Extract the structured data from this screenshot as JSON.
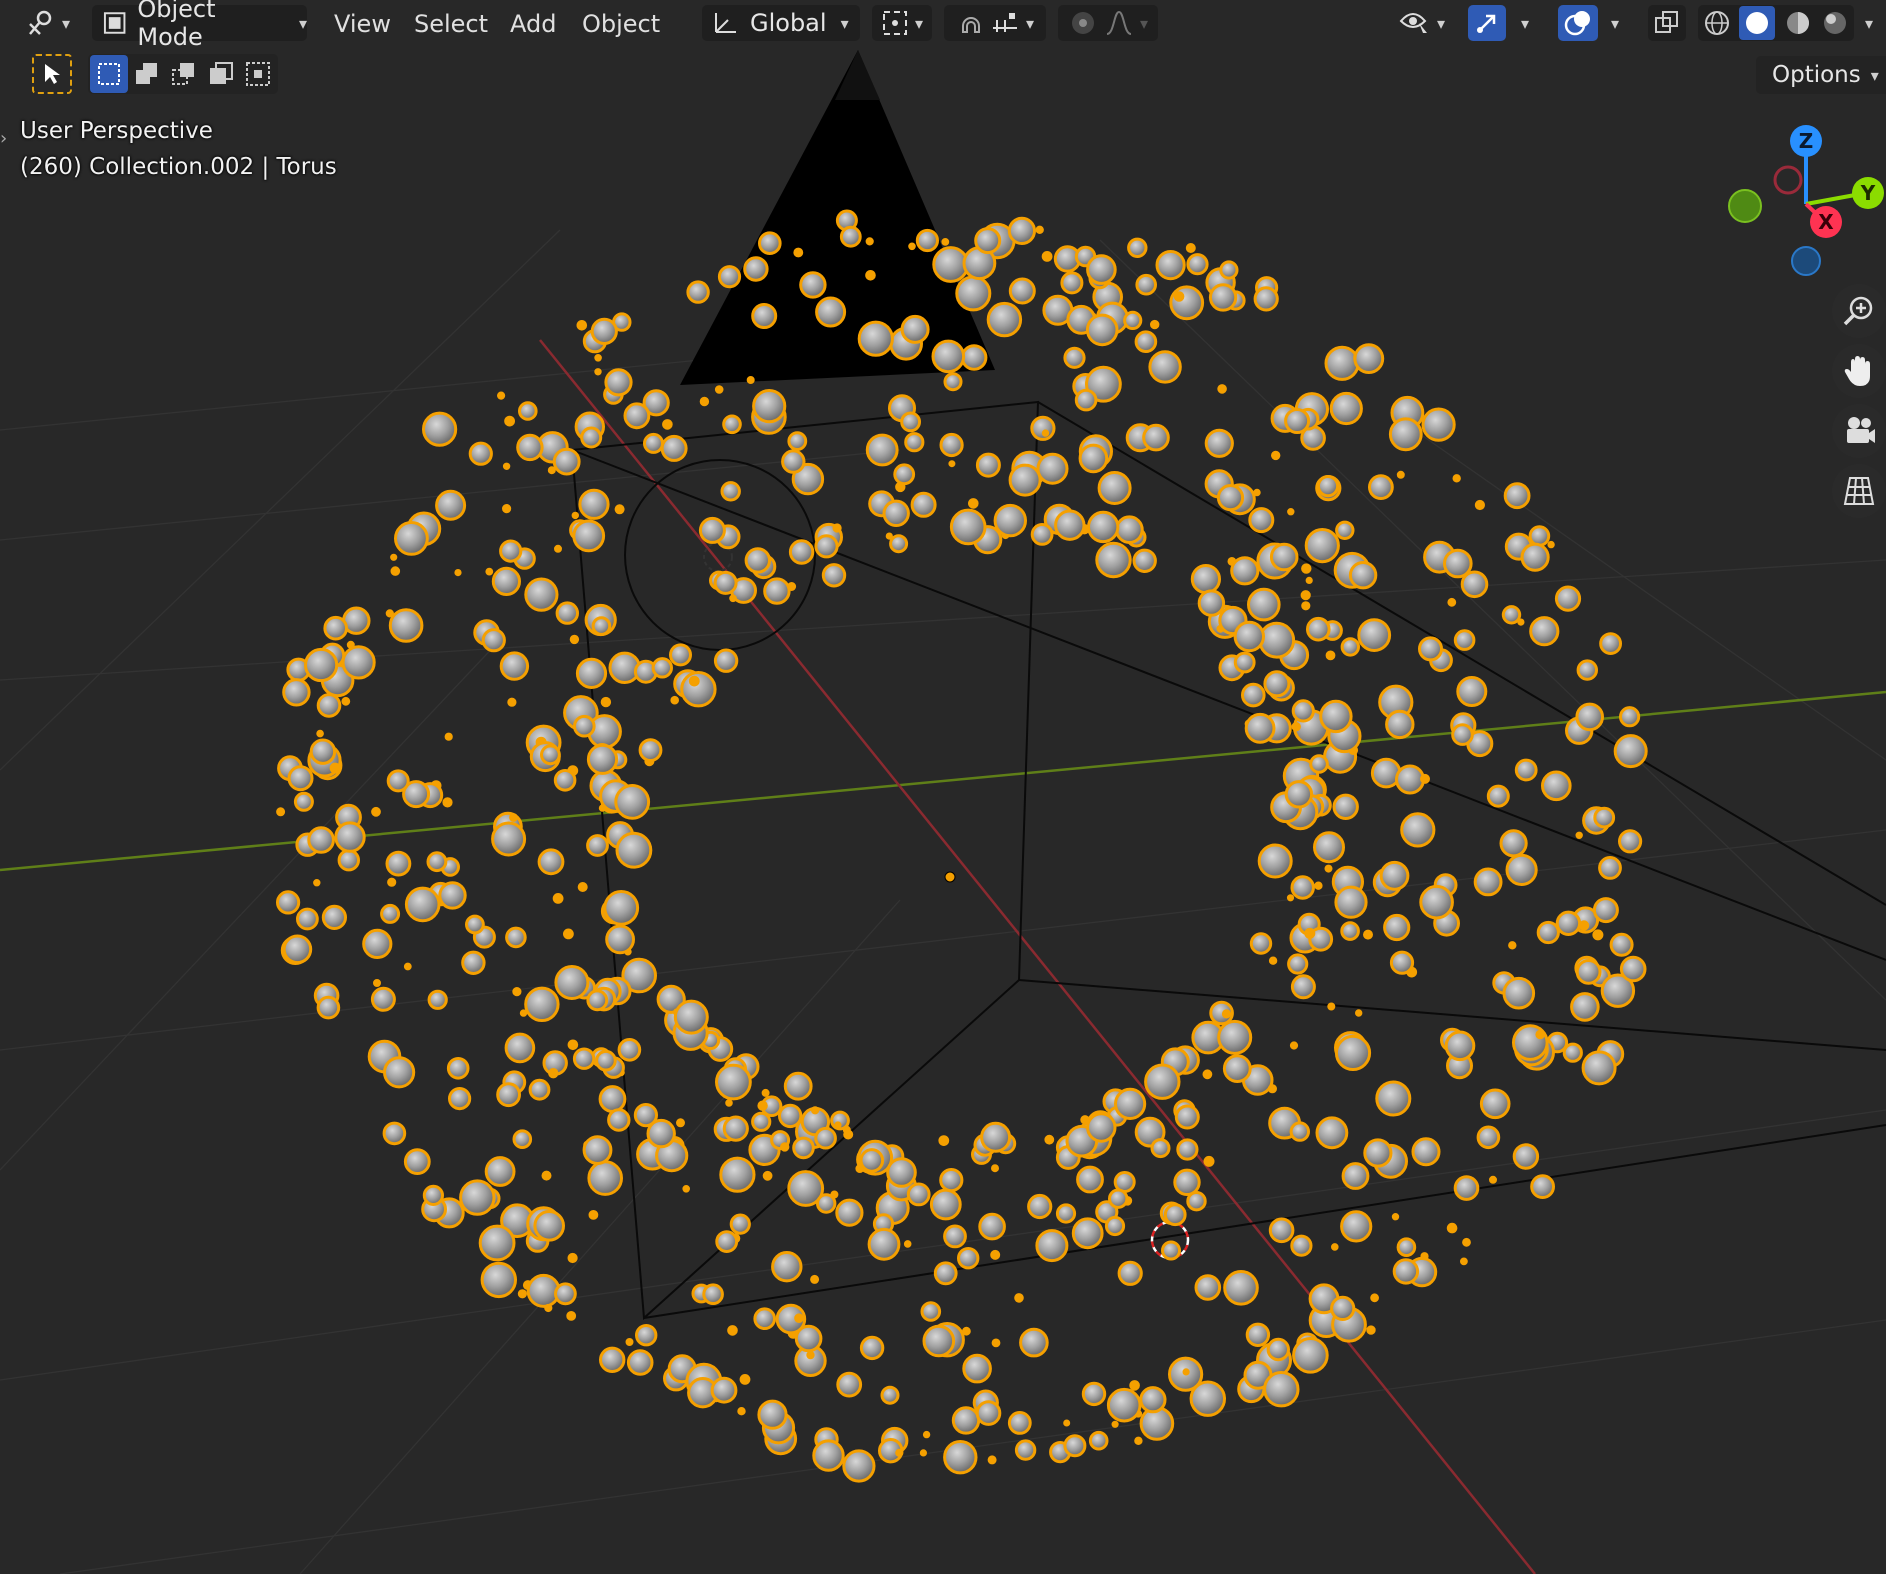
{
  "header": {
    "editor_type_icon": "editor-type-icon",
    "mode_label": "Object Mode",
    "menus": [
      "View",
      "Select",
      "Add",
      "Object"
    ],
    "transform_orientation": "Global"
  },
  "tools": {
    "select_tool": "cursor-select-icon",
    "select_modes": [
      "new-selection-icon",
      "extend-selection-icon",
      "subtract-selection-icon",
      "invert-selection-icon",
      "intersect-selection-icon"
    ]
  },
  "viewport": {
    "view_name": "User Perspective",
    "object_info": "(260) Collection.002 | Torus",
    "options_label": "Options"
  },
  "gizmo": {
    "axes": [
      "Z",
      "Y",
      "X"
    ],
    "colors": {
      "x": "#ff3352",
      "y": "#8bdc00",
      "z": "#2890ff",
      "selection": "#f5a000"
    }
  },
  "nav_buttons": [
    "zoom-icon",
    "pan-hand-icon",
    "camera-icon",
    "ortho-grid-icon"
  ],
  "colors": {
    "background": "#282828",
    "header": "#1f1f1f",
    "accent": "#2f5bb5",
    "selection_outline": "#f5a000",
    "particle": "#9a9a9a"
  }
}
